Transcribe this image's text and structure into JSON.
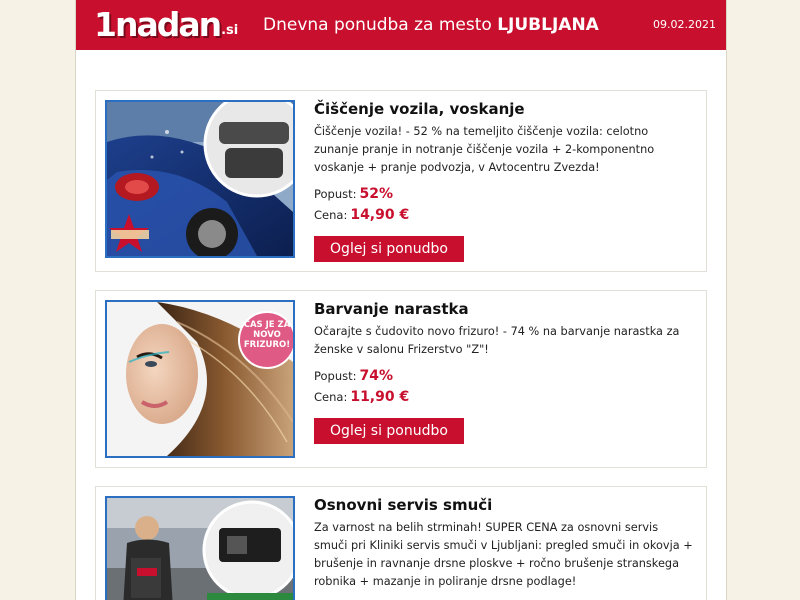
{
  "header": {
    "logo_text": "1nadan",
    "logo_tld": ".si",
    "title_prefix": "Dnevna ponudba za mesto",
    "city": "LJUBLJANA",
    "date": "09.02.2021"
  },
  "labels": {
    "discount": "Popust:",
    "price": "Cena:",
    "cta": "Oglej si ponudbo"
  },
  "deals": [
    {
      "title": "Čiščenje vozila, voskanje",
      "description": "Čiščenje vozila! - 52 % na temeljito čiščenje vozila: celotno zunanje pranje in notranje čiščenje vozila + 2-komponentno voskanje + pranje podvozja, v Avtocentru Zvezda!",
      "discount": "52%",
      "price": "14,90 €",
      "badge": "ZVEZDA",
      "image_icon": "car-wash-photo-icon"
    },
    {
      "title": "Barvanje narastka",
      "description": "Očarajte s čudovito novo frizuro! - 74 % na barvanje narastka za ženske v salonu Frizerstvo \"Z\"!",
      "discount": "74%",
      "price": "11,90 €",
      "badge": "ČAS JE ZA NOVO FRIZURO!",
      "image_icon": "hair-model-photo-icon"
    },
    {
      "title": "Osnovni servis smuči",
      "description": "Za varnost na belih strminah! SUPER CENA za osnovni servis smuči pri Kliniki servis smuči v Ljubljani: pregled smuči in okovja + brušenje in ravnanje drsne ploskve + ročno brušenje stranskega robnika + mazanje in poliranje drsne podlage!",
      "image_icon": "ski-service-photo-icon"
    }
  ],
  "colors": {
    "brand_red": "#c8102e",
    "page_bg": "#f6f3e6",
    "image_border": "#2b6fc2"
  }
}
